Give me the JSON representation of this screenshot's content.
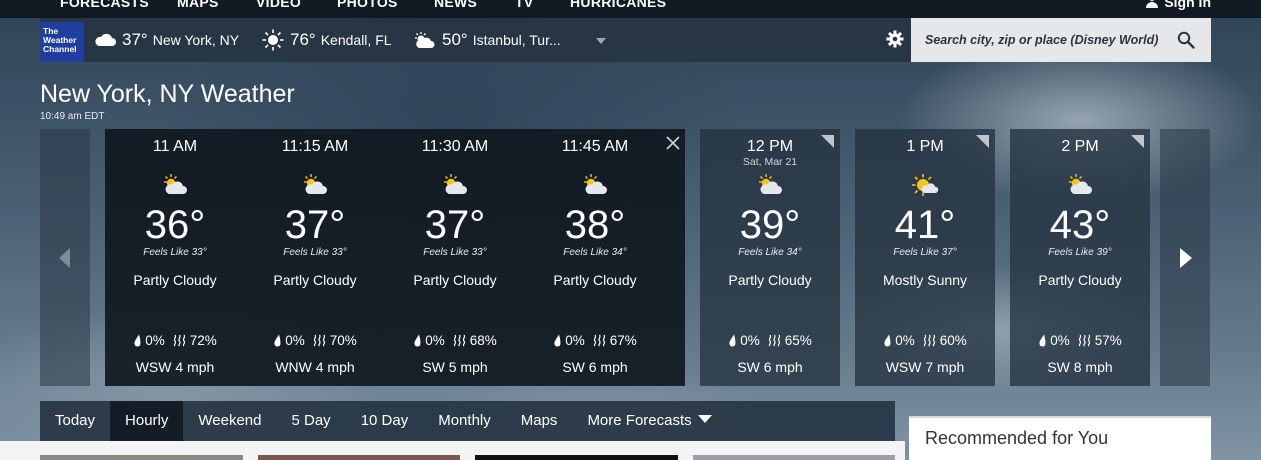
{
  "nav": {
    "links": [
      "FORECASTS",
      "MAPS",
      "VIDEO",
      "PHOTOS",
      "NEWS",
      "TV",
      "HURRICANES"
    ],
    "sign_in": "Sign In"
  },
  "logo": {
    "line1": "The",
    "line2": "Weather",
    "line3": "Channel"
  },
  "locations": [
    {
      "temp": "37°",
      "name": "New York, NY",
      "icon": "cloudy-icon"
    },
    {
      "temp": "76°",
      "name": "Kendall, FL",
      "icon": "sunny-icon"
    },
    {
      "temp": "50°",
      "name": "Istanbul, Tur...",
      "icon": "partly-cloudy-icon"
    }
  ],
  "search": {
    "placeholder": "Search city, zip or place (Disney World)"
  },
  "page": {
    "title": "New York, NY Weather",
    "timestamp": "10:49 am EDT"
  },
  "hourly": [
    {
      "time": "11 AM",
      "date": "",
      "temp": "36°",
      "feels": "Feels Like 33°",
      "cond": "Partly Cloudy",
      "precip": "0%",
      "humidity": "72%",
      "wind": "WSW 4 mph",
      "icon": "partly-cloudy-icon"
    },
    {
      "time": "11:15 AM",
      "date": "",
      "temp": "37°",
      "feels": "Feels Like 33°",
      "cond": "Partly Cloudy",
      "precip": "0%",
      "humidity": "70%",
      "wind": "WNW 4 mph",
      "icon": "partly-cloudy-icon"
    },
    {
      "time": "11:30 AM",
      "date": "",
      "temp": "37°",
      "feels": "Feels Like 33°",
      "cond": "Partly Cloudy",
      "precip": "0%",
      "humidity": "68%",
      "wind": "SW 5 mph",
      "icon": "partly-cloudy-icon"
    },
    {
      "time": "11:45 AM",
      "date": "",
      "temp": "38°",
      "feels": "Feels Like 34°",
      "cond": "Partly Cloudy",
      "precip": "0%",
      "humidity": "67%",
      "wind": "SW 6 mph",
      "icon": "partly-cloudy-icon"
    },
    {
      "time": "12 PM",
      "date": "Sat, Mar 21",
      "temp": "39°",
      "feels": "Feels Like 34°",
      "cond": "Partly Cloudy",
      "precip": "0%",
      "humidity": "65%",
      "wind": "SW 6 mph",
      "icon": "partly-cloudy-icon"
    },
    {
      "time": "1 PM",
      "date": "",
      "temp": "41°",
      "feels": "Feels Like 37°",
      "cond": "Mostly Sunny",
      "precip": "0%",
      "humidity": "60%",
      "wind": "WSW 7 mph",
      "icon": "mostly-sunny-icon"
    },
    {
      "time": "2 PM",
      "date": "",
      "temp": "43°",
      "feels": "Feels Like 39°",
      "cond": "Partly Cloudy",
      "precip": "0%",
      "humidity": "57%",
      "wind": "SW 8 mph",
      "icon": "partly-cloudy-icon"
    }
  ],
  "tabs": [
    "Today",
    "Hourly",
    "Weekend",
    "5 Day",
    "10 Day",
    "Monthly",
    "Maps",
    "More Forecasts"
  ],
  "active_tab": "Hourly",
  "sidebar": {
    "recommended": "Recommended for You"
  },
  "colors": {
    "logo_blue": "#1f3ea0",
    "sun_yellow": "#f5c518",
    "bar_bg": "#263442"
  }
}
